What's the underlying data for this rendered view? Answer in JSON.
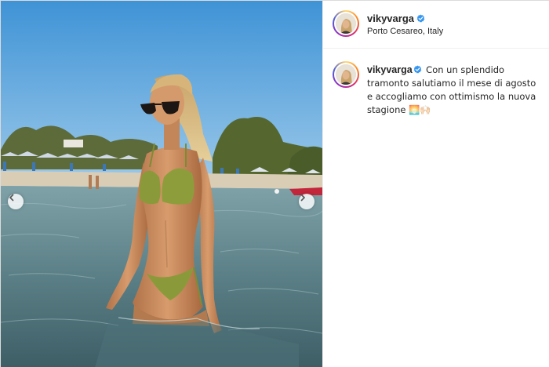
{
  "post": {
    "username": "vikyvarga",
    "verified": true,
    "location": "Porto Cesareo, Italy",
    "caption": {
      "username": "vikyvarga",
      "text": "Con un splendido tramonto salutiamo il mese di agosto e accogliamo con ottimismo la nuova stagione 🌅🙌🏻"
    }
  },
  "media": {
    "alt": "Woman in green bikini standing in sea water at the beach"
  },
  "icons": {
    "prev": "chevron-left-icon",
    "next": "chevron-right-icon",
    "verified": "verified-badge-icon"
  },
  "colors": {
    "verified": "#3897f0",
    "sky": "#5aa4dc",
    "sea": "#5a7f86",
    "bikini": "#8a9a3a"
  }
}
